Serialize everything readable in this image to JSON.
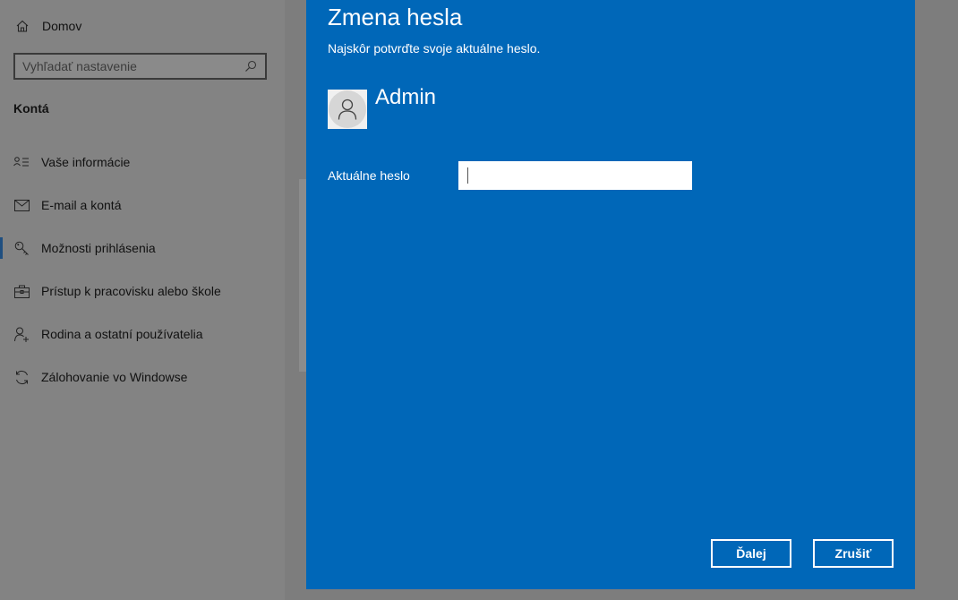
{
  "sidebar": {
    "home_label": "Domov",
    "search_placeholder": "Vyhľadať nastavenie",
    "section_title": "Kontá",
    "items": [
      {
        "label": "Vaše informácie",
        "icon": "person-card-icon"
      },
      {
        "label": "E-mail a kontá",
        "icon": "mail-icon"
      },
      {
        "label": "Možnosti prihlásenia",
        "icon": "key-icon",
        "selected": true
      },
      {
        "label": "Prístup k pracovisku alebo škole",
        "icon": "briefcase-icon"
      },
      {
        "label": "Rodina a ostatní používatelia",
        "icon": "add-person-icon"
      },
      {
        "label": "Zálohovanie vo Windowse",
        "icon": "sync-icon"
      }
    ]
  },
  "dialog": {
    "title": "Zmena hesla",
    "subtitle": "Najskôr potvrďte svoje aktuálne heslo.",
    "username": "Admin",
    "password_label": "Aktuálne heslo",
    "password_value": "",
    "next_label": "Ďalej",
    "cancel_label": "Zrušiť"
  },
  "colors": {
    "dialog_bg": "#0067b8",
    "sidebar_bg": "#838383",
    "accent": "#1f4f80"
  }
}
